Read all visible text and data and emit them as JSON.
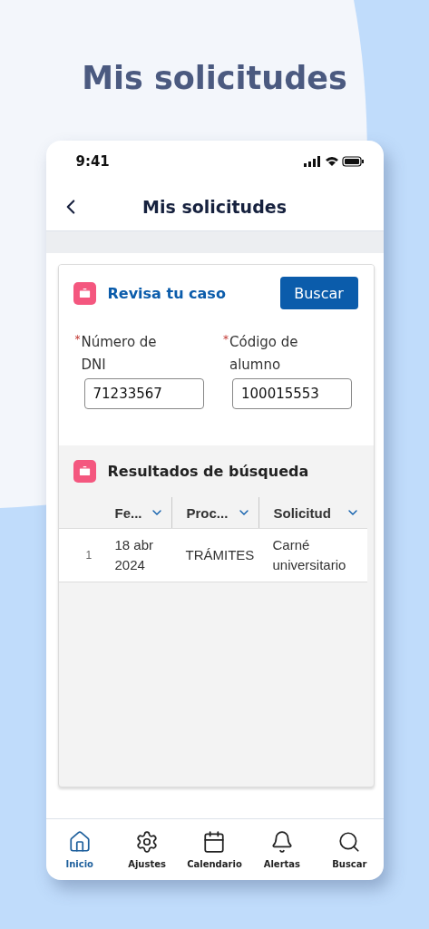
{
  "heading": "Mis solicitudes",
  "status_bar": {
    "time": "9:41"
  },
  "nav_bar": {
    "title": "Mis solicitudes"
  },
  "search_card": {
    "title": "Revisa tu caso",
    "button": "Buscar",
    "fields": [
      {
        "label": "Número de DNI",
        "required_mark": "*",
        "value": "71233567"
      },
      {
        "label": "Código de alumno",
        "required_mark": "*",
        "value": "100015553"
      }
    ]
  },
  "results": {
    "title": "Resultados de búsqueda",
    "columns": [
      "Fe...",
      "Proc...",
      "Solicitud"
    ],
    "rows": [
      {
        "number": "1",
        "cells": [
          "18 abr 2024",
          "TRÁMITES",
          "Carné universitario"
        ]
      }
    ]
  },
  "tab_bar": [
    {
      "label": "Inicio",
      "kind": "home",
      "selected": true
    },
    {
      "label": "Ajustes",
      "kind": "settings",
      "selected": false
    },
    {
      "label": "Calendario",
      "kind": "calendar",
      "selected": false
    },
    {
      "label": "Alertas",
      "kind": "bell",
      "selected": false
    },
    {
      "label": "Buscar",
      "kind": "search",
      "selected": false
    }
  ]
}
